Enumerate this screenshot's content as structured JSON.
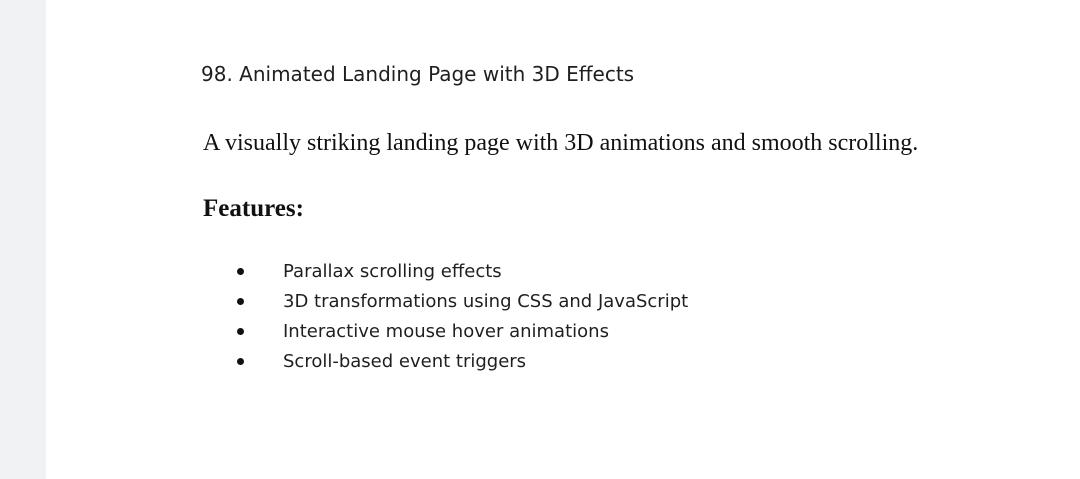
{
  "document": {
    "heading": "98. Animated Landing Page with 3D Effects",
    "description": "A visually striking landing page with 3D animations and smooth scrolling.",
    "features_label": "Features:",
    "features": [
      "Parallax scrolling effects",
      "3D transformations using CSS and JavaScript",
      "Interactive mouse hover animations",
      "Scroll-based event triggers"
    ]
  }
}
